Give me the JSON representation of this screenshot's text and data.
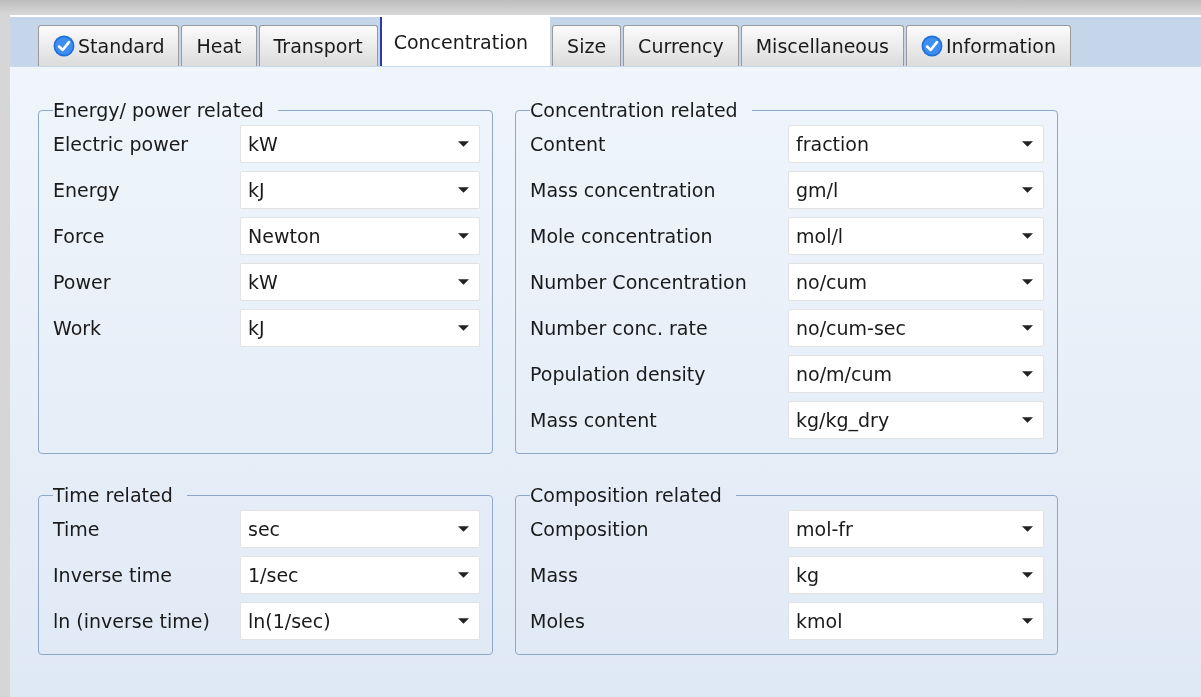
{
  "tabs": [
    {
      "label": "Standard",
      "selected": false,
      "checked": true
    },
    {
      "label": "Heat",
      "selected": false,
      "checked": false
    },
    {
      "label": "Transport",
      "selected": false,
      "checked": false
    },
    {
      "label": "Concentration",
      "selected": true,
      "checked": false
    },
    {
      "label": "Size",
      "selected": false,
      "checked": false
    },
    {
      "label": "Currency",
      "selected": false,
      "checked": false
    },
    {
      "label": "Miscellaneous",
      "selected": false,
      "checked": false
    },
    {
      "label": "Information",
      "selected": false,
      "checked": true
    }
  ],
  "groups": [
    {
      "title": "Energy/ power related",
      "fields": [
        {
          "label": "Electric power",
          "value": "kW"
        },
        {
          "label": "Energy",
          "value": "kJ"
        },
        {
          "label": "Force",
          "value": "Newton"
        },
        {
          "label": "Power",
          "value": "kW"
        },
        {
          "label": "Work",
          "value": "kJ"
        }
      ]
    },
    {
      "title": "Concentration related",
      "fields": [
        {
          "label": "Content",
          "value": "fraction"
        },
        {
          "label": "Mass concentration",
          "value": "gm/l"
        },
        {
          "label": "Mole concentration",
          "value": "mol/l"
        },
        {
          "label": "Number Concentration",
          "value": "no/cum"
        },
        {
          "label": "Number conc. rate",
          "value": "no/cum-sec"
        },
        {
          "label": "Population density",
          "value": "no/m/cum"
        },
        {
          "label": "Mass content",
          "value": "kg/kg_dry"
        }
      ]
    },
    {
      "title": "Time related",
      "fields": [
        {
          "label": "Time",
          "value": "sec"
        },
        {
          "label": "Inverse time",
          "value": "1/sec"
        },
        {
          "label": "ln (inverse time)",
          "value": "ln(1/sec)"
        }
      ]
    },
    {
      "title": "Composition related",
      "fields": [
        {
          "label": "Composition",
          "value": "mol-fr"
        },
        {
          "label": "Mass",
          "value": "kg"
        },
        {
          "label": "Moles",
          "value": "kmol"
        }
      ]
    }
  ]
}
